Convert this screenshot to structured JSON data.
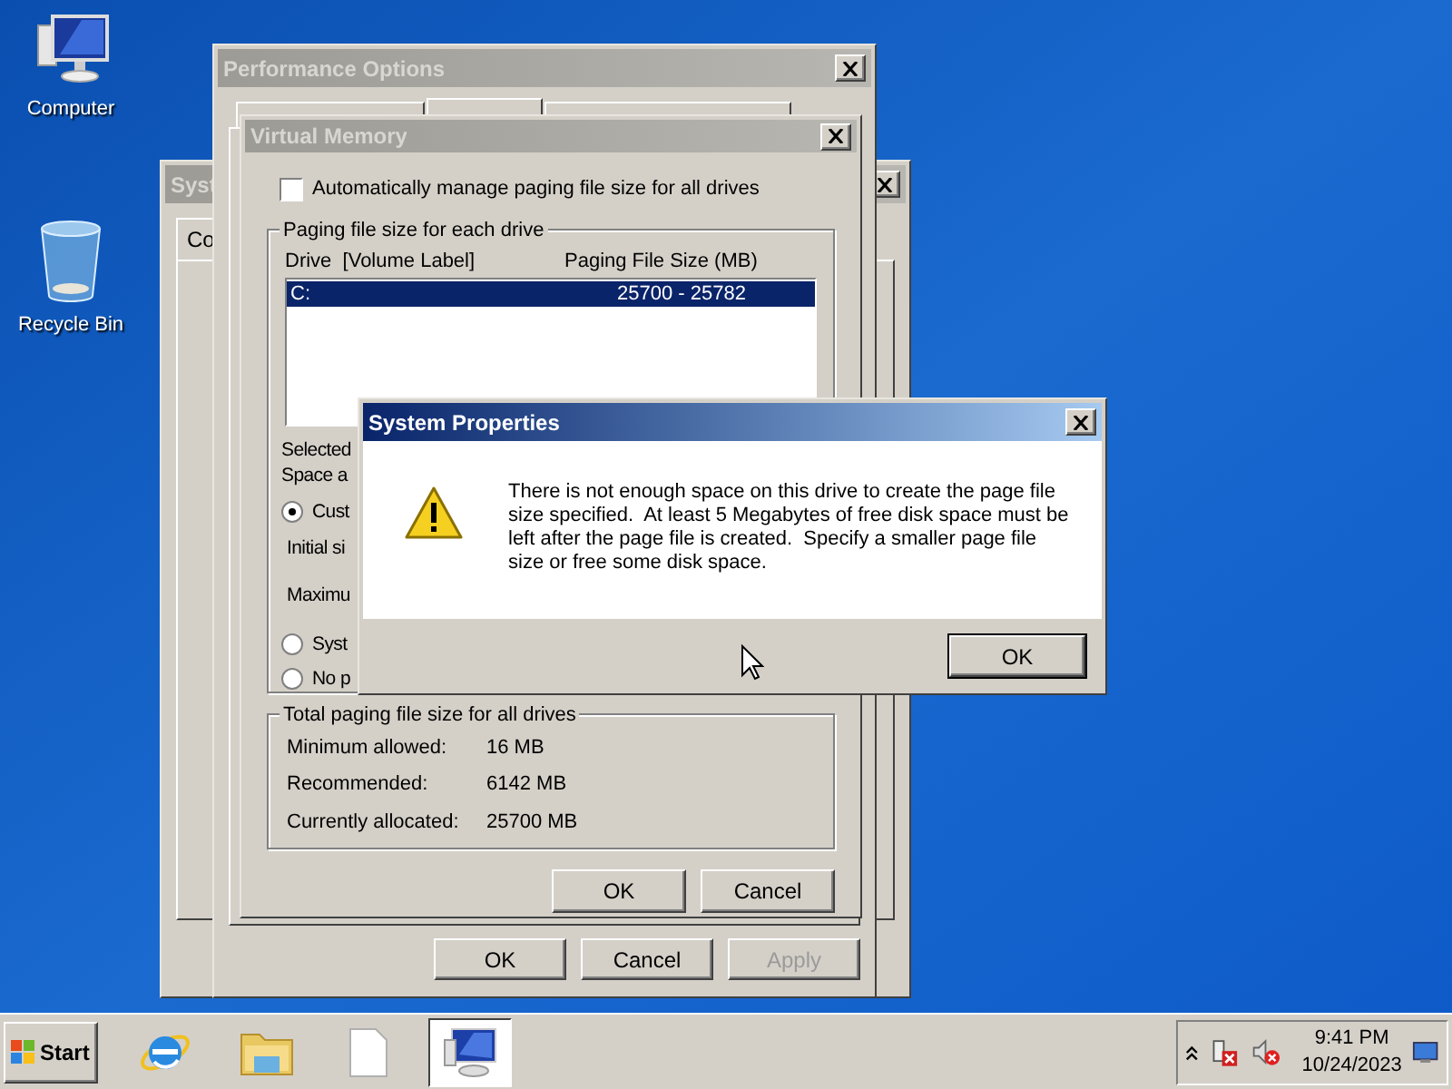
{
  "desktop_icons": [
    {
      "kind": "computer",
      "label": "Computer"
    },
    {
      "kind": "recycle",
      "label": "Recycle Bin"
    }
  ],
  "system_properties_back": {
    "title": "Syst",
    "tab": "Co"
  },
  "performance_options": {
    "title": "Performance Options",
    "buttons": [
      {
        "label": "OK",
        "disabled": false
      },
      {
        "label": "Cancel",
        "disabled": false
      },
      {
        "label": "Apply",
        "disabled": true
      }
    ]
  },
  "virtual_memory": {
    "title": "Virtual Memory",
    "auto_manage": {
      "label": "Automatically manage paging file size for all drives",
      "checked": false
    },
    "group_title": "Paging file size for each drive",
    "columns": [
      "Drive  [Volume Label]",
      "Paging File Size (MB)"
    ],
    "drives": [
      {
        "drive": "C:",
        "size": "25700 - 25782",
        "selected": true
      }
    ],
    "selected_drive_label": "Selected",
    "space_label": "Space a",
    "options": [
      {
        "label": "Cust",
        "selected": true
      },
      {
        "label": "Syst",
        "selected": false
      },
      {
        "label": "No p",
        "selected": false
      }
    ],
    "initial_label": "Initial si",
    "maximum_label": "Maximu",
    "totals": {
      "title": "Total paging file size for all drives",
      "rows": [
        {
          "label": "Minimum allowed:",
          "value": "16 MB"
        },
        {
          "label": "Recommended:",
          "value": "6142 MB"
        },
        {
          "label": "Currently allocated:",
          "value": "25700 MB"
        }
      ]
    },
    "buttons": [
      "OK",
      "Cancel"
    ]
  },
  "alert": {
    "title": "System Properties",
    "message": "There is not enough space on this drive to create the page file size specified.  At least 5 Megabytes of free disk space must be left after the page file is created.  Specify a smaller page file size or free some disk space.",
    "button": "OK"
  },
  "taskbar": {
    "start": "Start",
    "apps": [
      {
        "kind": "browser",
        "selected": false
      },
      {
        "kind": "folder",
        "selected": false
      },
      {
        "kind": "document",
        "selected": false
      },
      {
        "kind": "computer",
        "selected": true
      }
    ],
    "time": "9:41 PM",
    "date": "10/24/2023"
  }
}
